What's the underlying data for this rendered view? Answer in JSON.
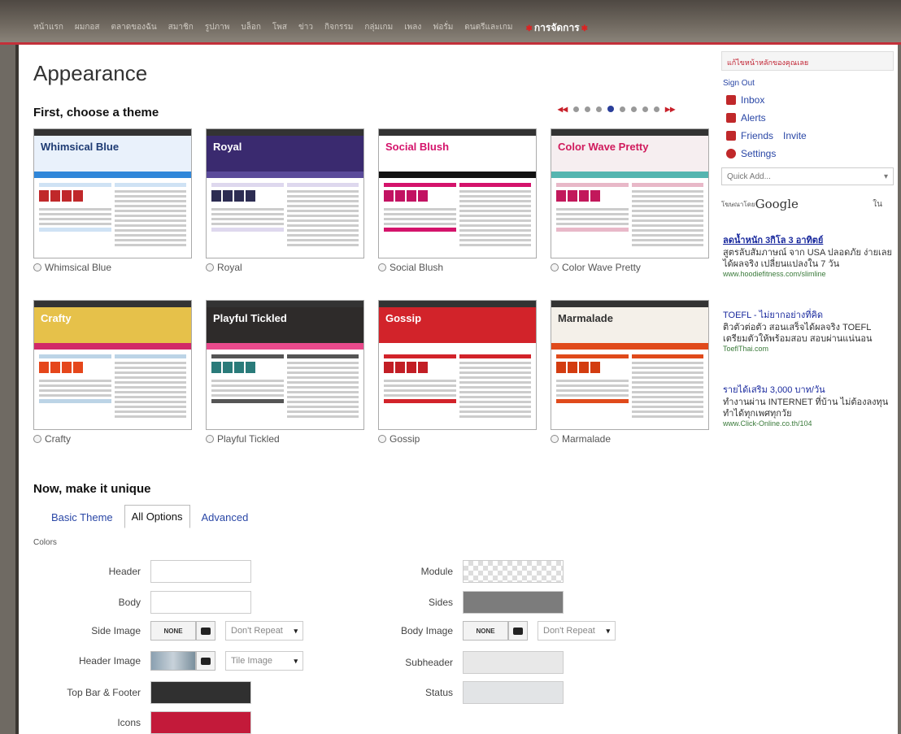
{
  "top_nav": {
    "items": [
      "หน้าแรก",
      "ผมกอส",
      "ตลาดของฉัน",
      "สมาชิก",
      "รูปภาพ",
      "บล็อก",
      "โพส",
      "ข่าว",
      "กิจกรรม",
      "กลุ่มเกม",
      "เพลง",
      "ฟอรั่ม",
      "ดนตรีและเกม"
    ],
    "active": "การจัดการ"
  },
  "page_title": "Appearance",
  "section_title": "First, choose a theme",
  "pager": {
    "prev": "◂◂",
    "next": "▸▸",
    "dots": 8,
    "current": 4
  },
  "themes": [
    {
      "name": "Whimsical Blue",
      "title": "Whimsical Blue",
      "head_bg": "#e9f1fb",
      "head_fg": "#1e3b73",
      "nav": "#2f86d9",
      "sq": "#c0282a",
      "bar": "#cfe2f4"
    },
    {
      "name": "Royal",
      "title": "Royal",
      "head_bg": "#3a2a6f",
      "head_fg": "#ffffff",
      "nav": "#5a4a9a",
      "sq": "#2c2c52",
      "bar": "#ded8ee"
    },
    {
      "name": "Social Blush",
      "title": "Social Blush",
      "head_bg": "#ffffff",
      "head_fg": "#d4136b",
      "nav": "#111111",
      "sq": "#c21262",
      "bar": "#d4136b"
    },
    {
      "name": "Color Wave Pretty",
      "title": "Color Wave Pretty",
      "head_bg": "#f6eef0",
      "head_fg": "#d01a5c",
      "nav": "#55b5b0",
      "sq": "#c2185b",
      "bar": "#e8b8c8"
    },
    {
      "name": "Crafty",
      "title": "Crafty",
      "head_bg": "#e6c14a",
      "head_fg": "#ffffff",
      "nav": "#d12968",
      "sq": "#e5461b",
      "bar": "#bcd4e6"
    },
    {
      "name": "Playful Tickled",
      "title": "Playful Tickled",
      "head_bg": "#2e2b2a",
      "head_fg": "#ffffff",
      "nav": "#e94a8c",
      "sq": "#2a7b7a",
      "bar": "#555555"
    },
    {
      "name": "Gossip",
      "title": "Gossip",
      "head_bg": "#d2232a",
      "head_fg": "#ffffff",
      "nav": "#ffffff",
      "sq": "#c21e25",
      "bar": "#d2232a"
    },
    {
      "name": "Marmalade",
      "title": "Marmalade",
      "head_bg": "#f4f0e9",
      "head_fg": "#333333",
      "nav": "#e04a1b",
      "sq": "#d33c10",
      "bar": "#e04a1b"
    }
  ],
  "unique": {
    "title": "Now, make it unique",
    "tabs": [
      "Basic Theme",
      "All Options",
      "Advanced"
    ],
    "active_tab": "All Options",
    "colors_label": "Colors"
  },
  "fields_left": [
    {
      "label": "Header",
      "kind": "swatch",
      "color": "#ffffff"
    },
    {
      "label": "Body",
      "kind": "swatch",
      "color": "#ffffff"
    },
    {
      "label": "Side Image",
      "kind": "image",
      "btn": "NONE",
      "select": "Don't Repeat"
    },
    {
      "label": "Header Image",
      "kind": "image-thumb",
      "select": "Tile Image"
    },
    {
      "label": "Top Bar & Footer",
      "kind": "swatch",
      "color": "#303030"
    },
    {
      "label": "Icons",
      "kind": "swatch",
      "color": "#c31a3a"
    }
  ],
  "fields_right": [
    {
      "label": "Module",
      "kind": "checker"
    },
    {
      "label": "Sides",
      "kind": "swatch",
      "color": "#7c7c7c"
    },
    {
      "label": "Body Image",
      "kind": "image",
      "btn": "NONE",
      "select": "Don't Repeat"
    },
    {
      "label": "Subheader",
      "kind": "swatch",
      "color": "#e8e8e8"
    },
    {
      "label": "Status",
      "kind": "swatch",
      "color": "#e2e4e6"
    }
  ],
  "sidebar": {
    "head": "แก้ไขหน้าหลักของคุณเลย",
    "sign_out": "Sign Out",
    "items": [
      {
        "label": "Inbox",
        "icon": "envelope-icon",
        "color": "#c0282a"
      },
      {
        "label": "Alerts",
        "icon": "flag-icon",
        "color": "#c0282a"
      },
      {
        "label": "Friends",
        "icon": "person-icon",
        "color": "#c0282a",
        "extra": "Invite"
      },
      {
        "label": "Settings",
        "icon": "gear-icon",
        "color": "#c0282a"
      }
    ],
    "quick_add": "Quick Add...",
    "ads_label": "โฆษณาโดย",
    "ads_brand": "Google",
    "ads_x": "ใน",
    "ads": [
      {
        "headline": "ลดน้ำหนัก 3กิโล 3 อาทิตย์",
        "text": "สูตรลับสัมภาษณ์ จาก USA ปลอดภัย ง่ายเลย ได้ผลจริง เปลี่ยนแปลงใน 7 วัน",
        "url": "www.hoodiefitness.com/slimline"
      },
      {
        "headline": "TOEFL - ไม่ยากอย่างที่คิด",
        "text": "ติวตัวต่อตัว สอนเสร็จได้ผลจริง TOEFL เตรียมตัวให้พร้อมสอบ สอบผ่านแน่นอน",
        "url": "ToeflThai.com"
      },
      {
        "headline": "รายได้เสริม 3,000 บาท/วัน",
        "text": "ทำงานผ่าน INTERNET ที่บ้าน ไม่ต้องลงทุน ทำได้ทุกเพศทุกวัย",
        "url": "www.Click-Online.co.th/104"
      }
    ]
  }
}
